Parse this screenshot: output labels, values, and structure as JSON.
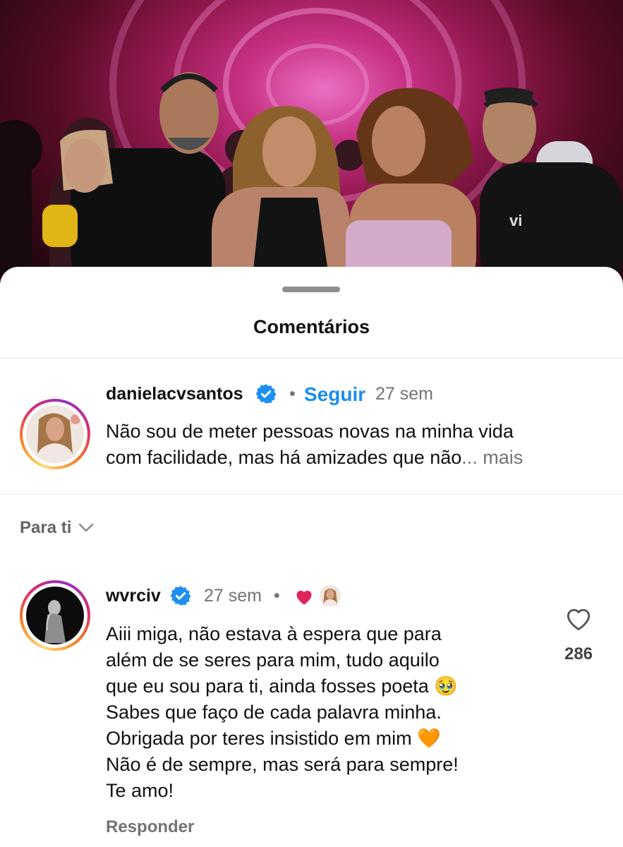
{
  "sheet": {
    "title": "Comentários"
  },
  "caption": {
    "username": "danielacvsantos",
    "follow_label": "Seguir",
    "separator": "•",
    "time": "27 sem",
    "line1": "Não sou de meter pessoas novas na minha vida",
    "line2": "com facilidade, mas há amizades que não",
    "more_label": "... mais"
  },
  "filter": {
    "label": "Para ti"
  },
  "comment": {
    "username": "wvrciv",
    "time": "27 sem",
    "separator": "•",
    "lines": [
      "Aiii miga, não estava à espera que para",
      "além de se seres para mim, tudo aquilo",
      "que eu sou para ti, ainda fosses poeta 🥹",
      "Sabes que faço de cada palavra minha.",
      "Obrigada por teres insistido em mim 🧡",
      "Não é de sempre, mas será para sempre!",
      "Te amo!"
    ],
    "like_count": "286",
    "reply_label": "Responder"
  },
  "colors": {
    "accent_blue": "#1a8cf0",
    "heart_red": "#e0245e",
    "verified_blue": "#1d8ff2",
    "muted_text": "#737373"
  },
  "icons": {
    "verified": "verified-badge-icon",
    "chevron": "chevron-down-icon",
    "like": "heart-outline-icon",
    "liked_by_author": "red-heart-icon"
  }
}
